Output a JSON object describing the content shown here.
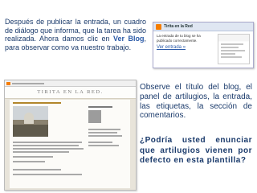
{
  "intro": {
    "before": "Después de publicar la entrada, un cuadro de diálogo que informa, que la tarea ha sido realizada. Ahora damos clic en ",
    "bold": "Ver Blog",
    "after": ", para observar como va nuestro trabajo."
  },
  "dialog": {
    "app_title": "Tirita en la Red",
    "message": "La entrada de tu blog se ha publicado correctamente.",
    "link": "Ver entrada »"
  },
  "blog_preview": {
    "header_title": "TIRITA EN LA RED."
  },
  "observe_text": "Observe el título del blog, el panel de artilugios, la entrada, las etiquetas, la sección de comentarios.",
  "question_text": "¿Podría usted enunciar que artilugios vienen por defecto en esta plantilla?"
}
